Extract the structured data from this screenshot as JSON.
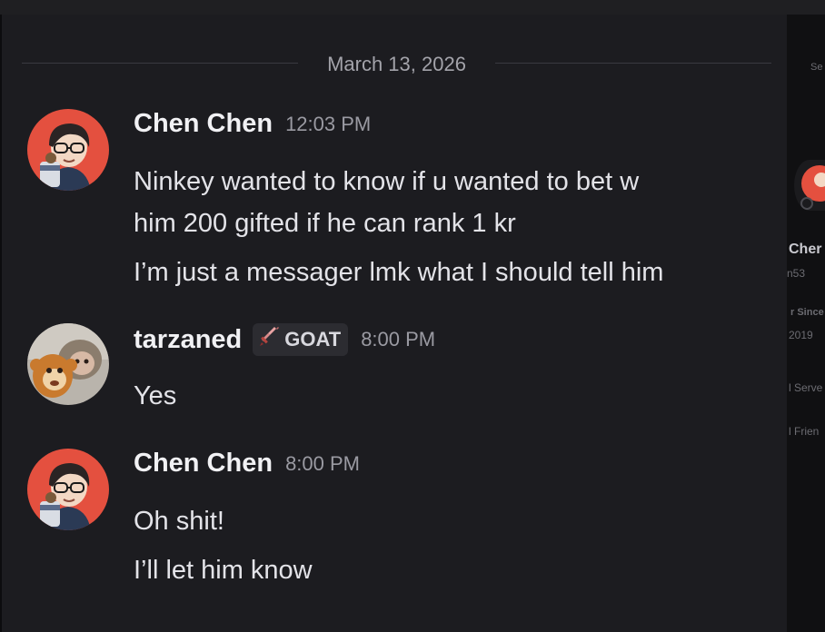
{
  "date_divider": "March 13, 2026",
  "messages": [
    {
      "username": "Chen Chen",
      "timestamp": "12:03 PM",
      "lines": [
        "Ninkey wanted to know if u wanted to bet w",
        "him 200 gifted if he can rank 1 kr",
        "I’m just a messager  lmk what I should tell him"
      ]
    },
    {
      "username": "tarzaned",
      "tag": "GOAT",
      "timestamp": "8:00 PM",
      "lines": [
        "Yes"
      ]
    },
    {
      "username": "Chen Chen",
      "timestamp": "8:00 PM",
      "lines": [
        "Oh shit!",
        "I’ll let him know"
      ]
    }
  ],
  "profile_panel": {
    "name": "Cher",
    "handle": "n53",
    "member_since_label": "r Since",
    "member_since_year": "2019",
    "servers_label": "l Serve",
    "friends_label": "l Frien",
    "top_label": "Se"
  },
  "colors": {
    "background": "#1c1c20",
    "avatar_red": "#e4503f",
    "tag_bg": "#2c2c31"
  }
}
